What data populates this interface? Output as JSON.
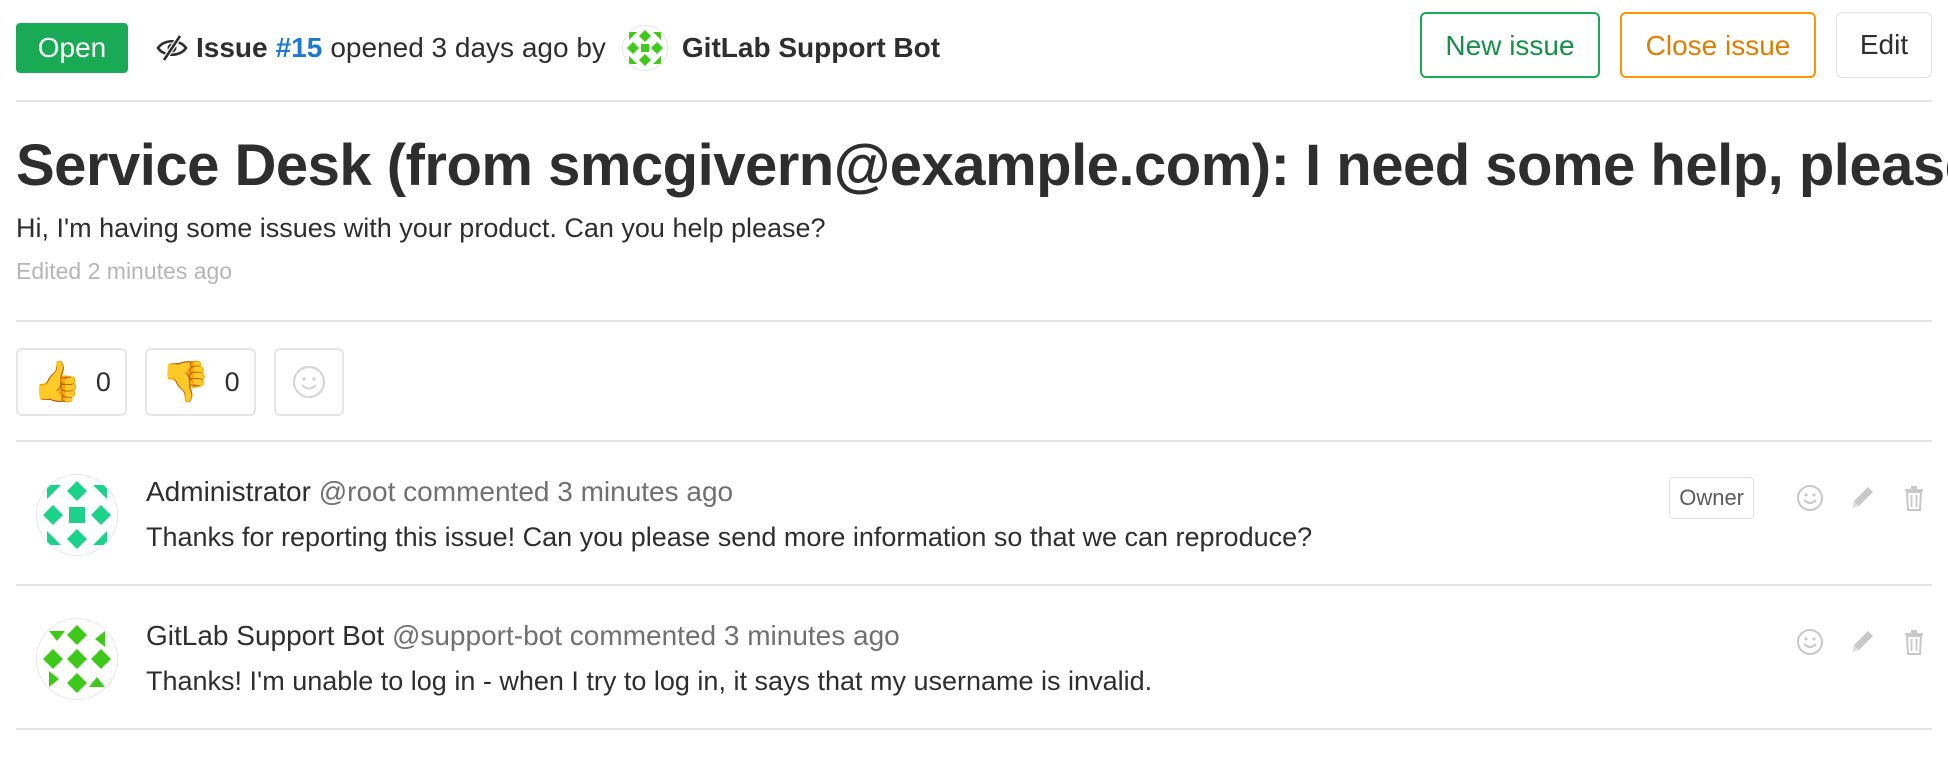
{
  "header": {
    "status": "Open",
    "issue_word": "Issue",
    "issue_ref": "#15",
    "opened_text": "opened 3 days ago by",
    "author": "GitLab Support Bot",
    "buttons": {
      "new_issue": "New issue",
      "close_issue": "Close issue",
      "edit": "Edit"
    }
  },
  "issue": {
    "title": "Service Desk (from smcgivern@example.com): I need some help, please",
    "description": "Hi, I'm having some issues with your product. Can you help please?",
    "edited": "Edited 2 minutes ago"
  },
  "awards": {
    "thumbs_up": {
      "emoji": "👍",
      "count": "0"
    },
    "thumbs_down": {
      "emoji": "👎",
      "count": "0"
    }
  },
  "notes": [
    {
      "author_name": "Administrator",
      "username": "@root",
      "meta": "commented 3 minutes ago",
      "body": "Thanks for reporting this issue! Can you please send more information so that we can reproduce?",
      "role": "Owner"
    },
    {
      "author_name": "GitLab Support Bot",
      "username": "@support-bot",
      "meta": "commented 3 minutes ago",
      "body": "Thanks! I'm unable to log in - when I try to log in, it says that my username is invalid."
    }
  ],
  "colors": {
    "open_badge": "#1aaa55",
    "link": "#1f78d1",
    "close_button": "#fc9403",
    "avatar_admin": "#1cd28a",
    "avatar_bot": "#3ec81a"
  }
}
